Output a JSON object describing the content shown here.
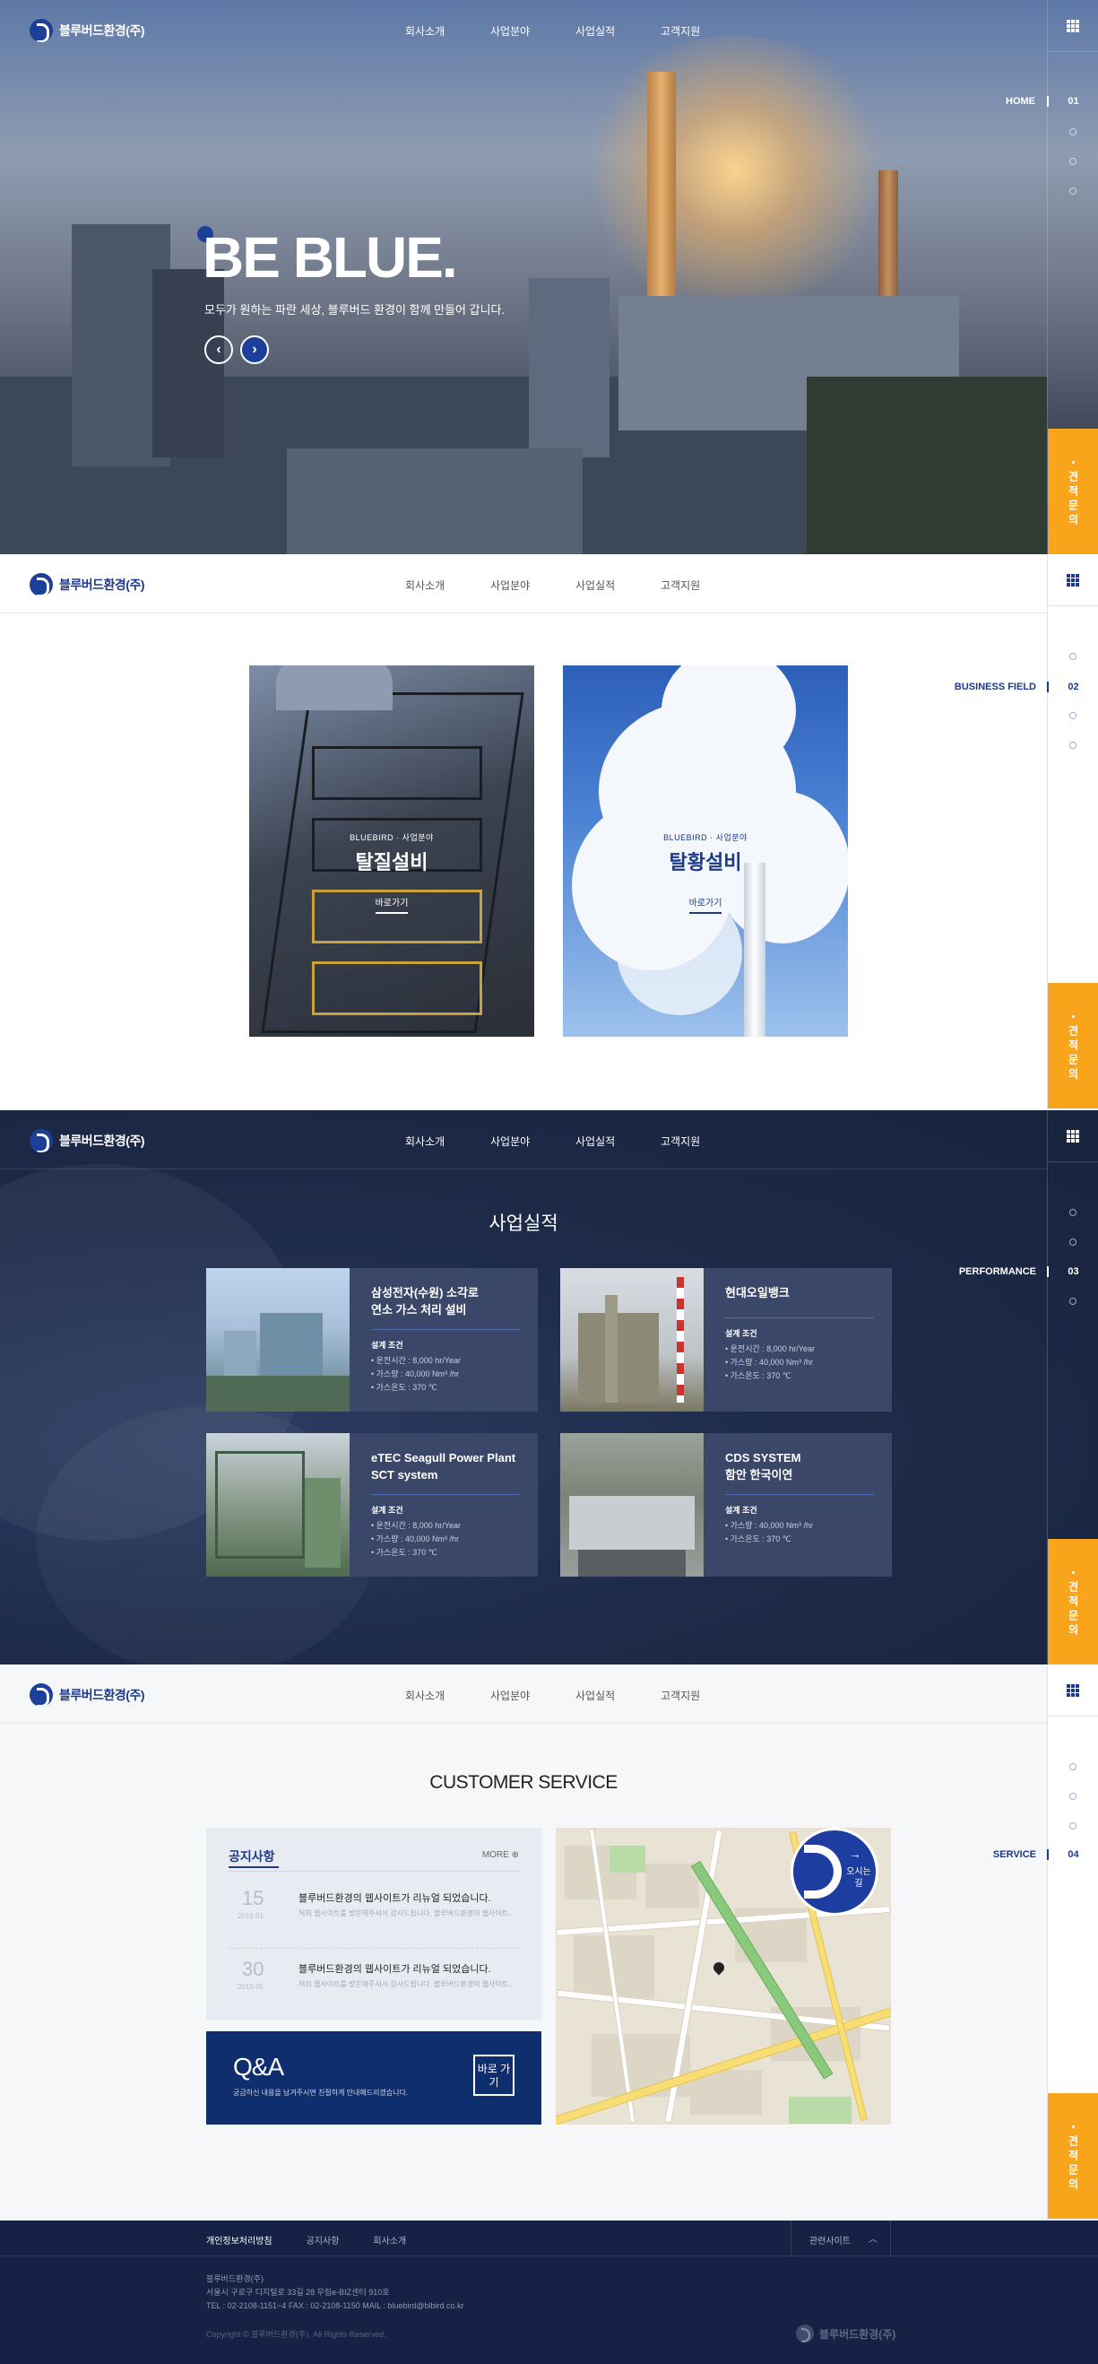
{
  "brand": {
    "name": "블루버드환경(주)"
  },
  "nav": {
    "items": [
      "회사소개",
      "사업분야",
      "사업실적",
      "고객지원"
    ]
  },
  "rail": {
    "quote_label": "견적문의",
    "sections": [
      {
        "num": "01",
        "label": "HOME"
      },
      {
        "num": "02",
        "label": "BUSINESS FIELD"
      },
      {
        "num": "03",
        "label": "PERFORMANCE"
      },
      {
        "num": "04",
        "label": "SERVICE"
      }
    ]
  },
  "hero": {
    "title": "BE BLUE.",
    "subtitle": "모두가 원하는 파란 세상, 블루버드 환경이 함께 만들어 갑니다.",
    "prev_icon": "chevron-left-icon",
    "next_icon": "chevron-right-icon"
  },
  "business": {
    "cards": [
      {
        "small": "BLUEBIRD · 사업분야",
        "title": "탈질설비",
        "link": "바로가기"
      },
      {
        "small": "BLUEBIRD · 사업분야",
        "title": "탈황설비",
        "link": "바로가기"
      }
    ]
  },
  "performance": {
    "title": "사업실적",
    "cards": [
      {
        "title1": "삼성전자(수원) 소각로",
        "title2": "연소 가스 처리 설비",
        "heading": "설계 조건",
        "lines": [
          "• 운전시간 : 8,000 hr/Year",
          "• 가스량 : 40,000 Nm³ /hr",
          "• 가스온도 : 370 ℃"
        ]
      },
      {
        "title1": "현대오일뱅크",
        "title2": "",
        "heading": "설계 조건",
        "lines": [
          "• 운전시간 : 8,000 hr/Year",
          "• 가스량 : 40,000 Nm³ /hr",
          "• 가스온도 : 370 ℃"
        ]
      },
      {
        "title1": "eTEC Seagull Power Plant",
        "title2": "SCT system",
        "heading": "설계 조건",
        "lines": [
          "• 운전시간 : 8,000 hr/Year",
          "• 가스량 : 40,000 Nm³ /hr",
          "• 가스온도 : 370 ℃"
        ]
      },
      {
        "title1": "CDS SYSTEM",
        "title2": "함안 한국이연",
        "heading": "설계 조건",
        "lines": [
          "• 가스량 : 40,000 Nm³ /hr",
          "• 가스온도 : 370 ℃"
        ]
      }
    ]
  },
  "service": {
    "title": "CUSTOMER SERVICE",
    "notice": {
      "heading": "공지사항",
      "more": "MORE ⊕",
      "items": [
        {
          "day": "15",
          "ym": "2019.01",
          "title": "블루버드환경의 웹사이트가 리뉴얼 되었습니다.",
          "desc": "저희 웹사이트를 방문해주셔서 감사드립니다. 블루버드환경의 웹사이트..."
        },
        {
          "day": "30",
          "ym": "2019.05",
          "title": "블루버드환경의 웹사이트가 리뉴얼 되었습니다.",
          "desc": "저희 웹사이트를 방문해주셔서 감사드립니다. 블루버드환경의 웹사이트..."
        }
      ]
    },
    "qna": {
      "title": "Q&A",
      "desc": "궁금하신 내용을 남겨주시면 친절하게 안내해드리겠습니다.",
      "button": "바로 가기"
    },
    "map": {
      "badge_arrow": "→",
      "badge_text": "오시는 길"
    }
  },
  "footer": {
    "links": [
      "개인정보처리방침",
      "공지사항",
      "회사소개"
    ],
    "family_site": "관련사이트",
    "company": "블루버드환경(주)",
    "address": "서울시 구로구 디지털로 33길 28 우림e-BIZ센터 910호",
    "contact": "TEL : 02-2108-1151~4    FAX : 02-2108-1150    MAIL : bluebird@blbird.co.kr",
    "copyright": "Copyright © 블루버드환경(주). All Rights Reserved."
  }
}
